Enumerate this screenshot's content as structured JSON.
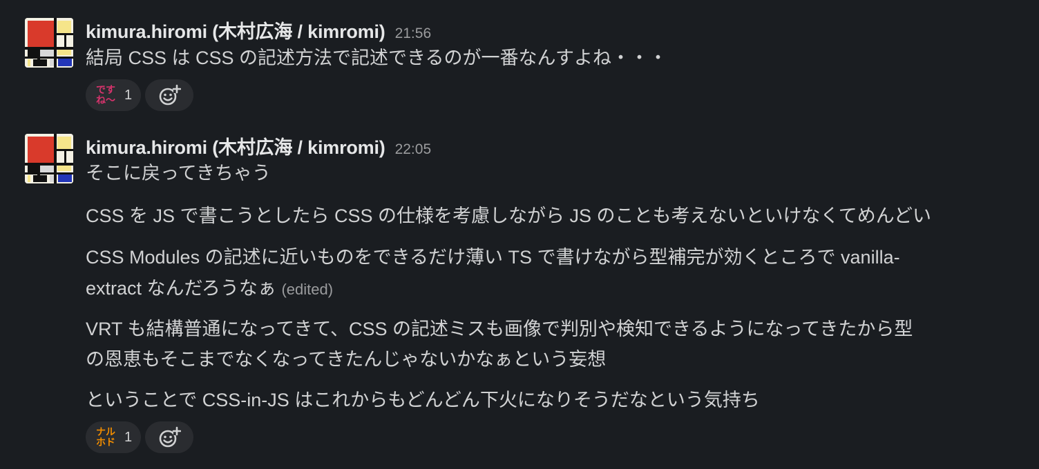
{
  "messages": [
    {
      "author": "kimura.hiromi (木村広海 / kimromi)",
      "time": "21:56",
      "lines": [
        "結局 CSS は CSS の記述方法で記述できるのが一番なんすよね・・・"
      ],
      "reaction": {
        "emoji_text": [
          "です",
          "ね〜"
        ],
        "emoji_color": "#d6336c",
        "count": "1"
      }
    },
    {
      "author": "kimura.hiromi (木村広海 / kimromi)",
      "time": "22:05",
      "lines": [
        "そこに戻ってきちゃう",
        "CSS を JS で書こうとしたら CSS の仕様を考慮しながら JS のことも考えないといけなくてめんどい",
        "CSS Modules の記述に近いものをできるだけ薄い TS で書けながら型補完が効くところで vanilla-",
        "extract なんだろうなぁ",
        "VRT も結構普通になってきて、CSS の記述ミスも画像で判別や検知できるようになってきたから型",
        "の恩恵もそこまでなくなってきたんじゃないかなぁという妄想",
        "ということで CSS-in-JS はこれからもどんどん下火になりそうだなという気持ち"
      ],
      "edited_label": "(edited)",
      "reaction": {
        "emoji_text": [
          "ナル",
          "ホド"
        ],
        "emoji_color": "#f08c00",
        "count": "1"
      }
    }
  ],
  "icons": {
    "add_reaction": "smiley-plus-icon",
    "avatar": "mondrian-avatar"
  },
  "colors": {
    "background": "#1a1d21",
    "text": "#d1d2d3",
    "muted": "#9b9c9e",
    "pill": "#2a2c30"
  }
}
